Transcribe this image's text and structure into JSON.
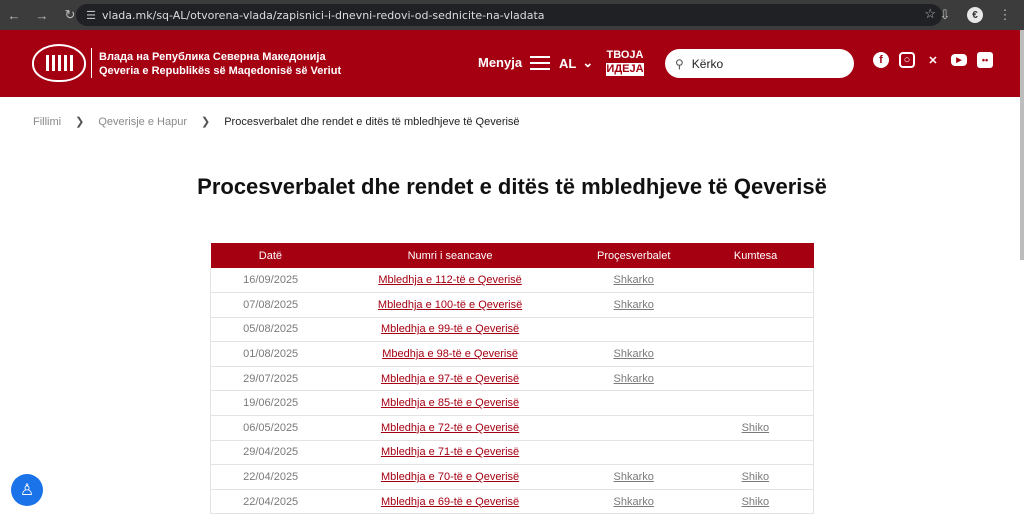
{
  "browser": {
    "url": "vlada.mk/sq-AL/otvorena-vlada/zapisnici-i-dnevni-redovi-od-sednicite-na-vladata",
    "icons": [
      "back-arrow-icon",
      "forward-arrow-icon",
      "reload-icon",
      "site-settings-icon",
      "bookmark-star-icon",
      "download-icon",
      "profile-icon",
      "more-menu-icon"
    ],
    "profile_initial": "€"
  },
  "header": {
    "logo_line1": "Влада на Република Северна Македонија",
    "logo_line2": "Qeveria e Republikës së Maqedonisë së Veriut",
    "menu_label": "Menyja",
    "lang_label": "AL",
    "tvoja_line1": "ТВОЈА",
    "tvoja_line2": "ИДЕЈА",
    "search_placeholder": "Kërko",
    "social_icons": [
      "facebook-icon",
      "instagram-icon",
      "x-icon",
      "youtube-icon",
      "flickr-icon"
    ],
    "brand_color": "#a50012"
  },
  "breadcrumb": {
    "items": [
      "Fillimi",
      "Qeverisje e Hapur"
    ],
    "current": "Procesverbalet dhe rendet e ditës të mbledhjeve të Qeverisë"
  },
  "page": {
    "title": "Procesverbalet dhe rendet e ditës të mbledhjeve të Qeverisë"
  },
  "table": {
    "headers": [
      "Datë",
      "Numri i seancave",
      "Proçesverbalet",
      "Kumtesa"
    ],
    "rows": [
      {
        "date": "16/09/2025",
        "session": "Mbledhja e 112-të e Qeverisë",
        "minutes": "Shkarko",
        "conclusions": ""
      },
      {
        "date": "07/08/2025",
        "session": "Mbledhja e 100-të e Qeverisë",
        "minutes": "Shkarko",
        "conclusions": ""
      },
      {
        "date": "05/08/2025",
        "session": "Mbledhja e 99-të e Qeverisë",
        "minutes": "",
        "conclusions": ""
      },
      {
        "date": "01/08/2025",
        "session": "Mbedhja e 98-të e Qeverisë",
        "minutes": "Shkarko",
        "conclusions": ""
      },
      {
        "date": "29/07/2025",
        "session": "Mbledhja e 97-të e Qeverisë",
        "minutes": "Shkarko",
        "conclusions": ""
      },
      {
        "date": "19/06/2025",
        "session": "Mbledhja e 85-të e Qeverisë",
        "minutes": "",
        "conclusions": ""
      },
      {
        "date": "06/05/2025",
        "session": "Mbledhja e 72-të e Qeverisë",
        "minutes": "",
        "conclusions": "Shiko"
      },
      {
        "date": "29/04/2025",
        "session": "Mbledhja e 71-të e Qeverisë",
        "minutes": "",
        "conclusions": ""
      },
      {
        "date": "22/04/2025",
        "session": "Mbledhja e 70-të e Qeverisë",
        "minutes": "Shkarko",
        "conclusions": "Shiko"
      },
      {
        "date": "22/04/2025",
        "session": "Mbledhja e 69-të e Qeverisë",
        "minutes": "Shkarko",
        "conclusions": "Shiko"
      }
    ]
  },
  "accessibility": {
    "icon": "accessibility-icon"
  }
}
